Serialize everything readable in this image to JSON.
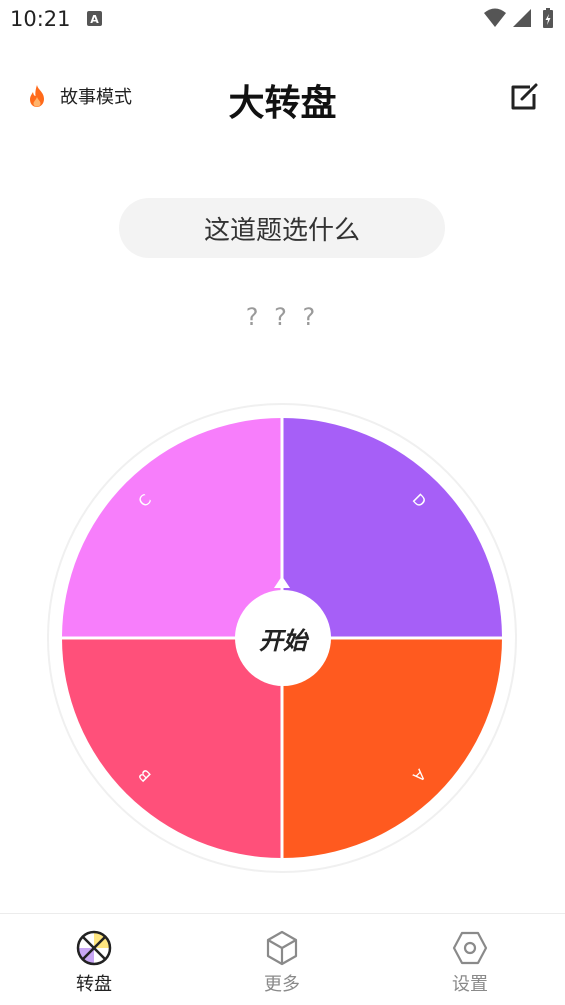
{
  "status_bar": {
    "time": "10:21",
    "icons": [
      "notification-a-icon",
      "wifi-icon",
      "signal-icon",
      "battery-icon"
    ]
  },
  "header": {
    "story_mode_label": "故事模式",
    "title": "大转盘",
    "icons": [
      "fire-icon",
      "edit-icon"
    ]
  },
  "question": "这道题选什么",
  "result": "? ? ?",
  "wheel": {
    "segments": [
      {
        "label": "D",
        "color": "#a65ff7"
      },
      {
        "label": "A",
        "color": "#ff5a1f"
      },
      {
        "label": "B",
        "color": "#ff507a"
      },
      {
        "label": "C",
        "color": "#f77efb"
      }
    ],
    "start_label": "开始",
    "pointer_icon": "pointer-arrow-icon"
  },
  "bottom_nav": {
    "items": [
      {
        "label": "转盘",
        "icon": "wheel-icon",
        "active": true
      },
      {
        "label": "更多",
        "icon": "cube-icon",
        "active": false
      },
      {
        "label": "设置",
        "icon": "settings-hex-icon",
        "active": false
      }
    ]
  },
  "colors": {
    "accent_fire": "#ff6a1a",
    "pill_bg": "#f3f3f3",
    "inactive": "#8a8a8a"
  }
}
